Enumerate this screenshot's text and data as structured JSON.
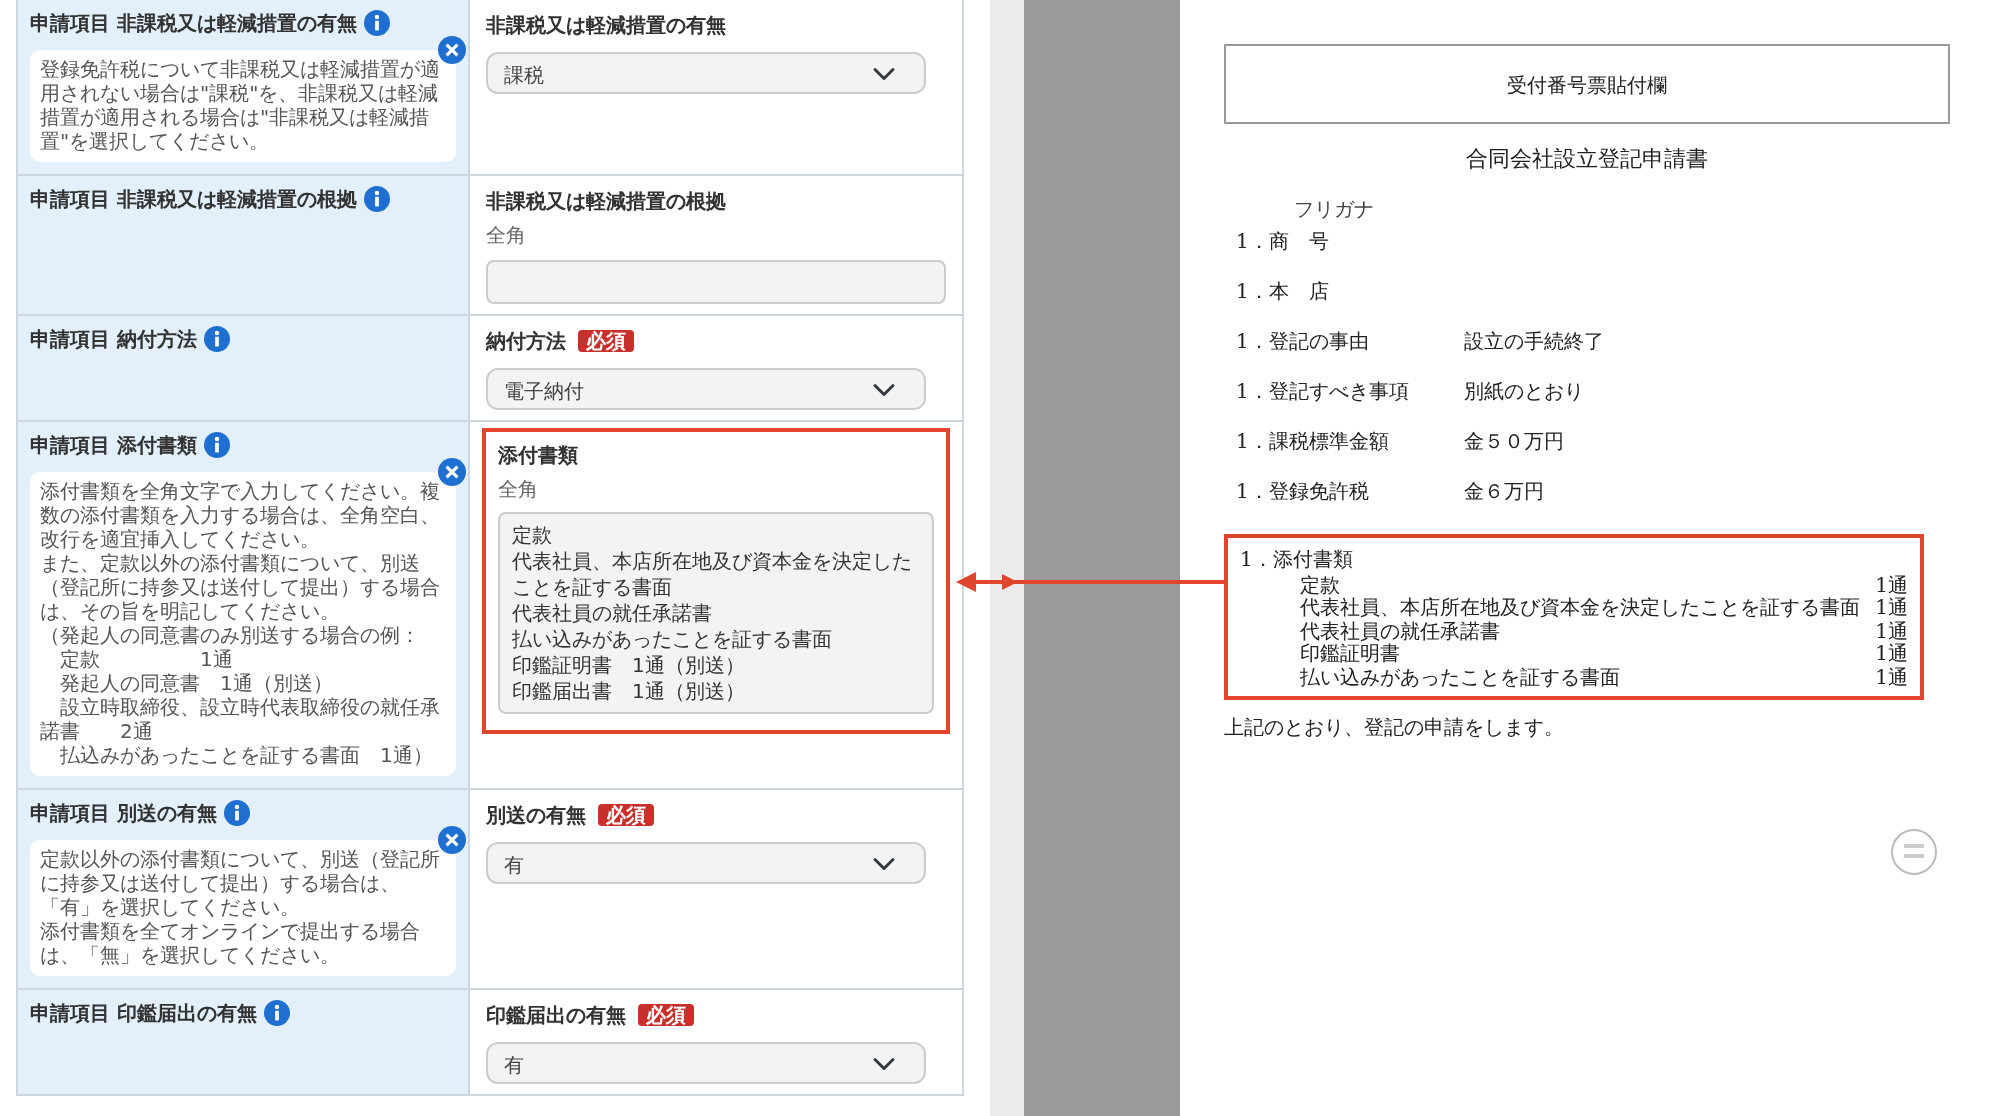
{
  "form": {
    "rows": [
      {
        "label": "申請項目 非課税又は軽減措置の有無",
        "help": [
          "登録免許税について非課税又は軽減措置が適用されない場合は\"課税\"を、非課税又は軽減措置が適用される場合は\"非課税又は軽減措置\"を選択してください。"
        ],
        "field": {
          "kind": "select",
          "label": "非課税又は軽減措置の有無",
          "value": "課税",
          "highlighted": false
        }
      },
      {
        "label": "申請項目 非課税又は軽減措置の根拠",
        "field": {
          "kind": "text",
          "label": "非課税又は軽減措置の根拠",
          "note": "全角",
          "highlighted": false
        }
      },
      {
        "label": "申請項目 納付方法",
        "field": {
          "kind": "select",
          "label": "納付方法",
          "required_badge": "必須",
          "value": "電子納付",
          "highlighted": false
        }
      },
      {
        "label": "申請項目 添付書類",
        "help": [
          "添付書類を全角文字で入力してください。複数の添付書類を入力する場合は、全角空白、改行を適宜挿入してください。",
          "また、定款以外の添付書類について、別送（登記所に持参又は送付して提出）する場合は、その旨を明記してください。",
          "（発起人の同意書のみ別送する場合の例：",
          "　定款　　　　　1通",
          "　発起人の同意書　1通（別送）",
          "　設立時取締役、設立時代表取締役の就任承諾書　　2通",
          "　払込みがあったことを証する書面　1通）"
        ],
        "field": {
          "kind": "textarea",
          "label": "添付書類",
          "note": "全角",
          "lines": [
            "定款",
            "代表社員、本店所在地及び資本金を決定したことを証する書面",
            "代表社員の就任承諾書",
            "払い込みがあったことを証する書面",
            "印鑑証明書　1通（別送）",
            "印鑑届出書　1通（別送）"
          ],
          "highlighted": true
        }
      },
      {
        "label": "申請項目 別送の有無",
        "help": [
          "定款以外の添付書類について、別送（登記所に持参又は送付して提出）する場合は、「有」を選択してください。",
          "添付書類を全てオンラインで提出する場合は、「無」を選択してください。"
        ],
        "field": {
          "kind": "select",
          "label": "別送の有無",
          "required_badge": "必須",
          "value": "有",
          "highlighted": false
        }
      },
      {
        "label": "申請項目 印鑑届出の有無",
        "field": {
          "kind": "select",
          "label": "印鑑届出の有無",
          "required_badge": "必須",
          "value": "有",
          "highlighted": false
        }
      }
    ]
  },
  "document": {
    "stamp_box": "受付番号票貼付欄",
    "title": "合同会社設立登記申請書",
    "items": [
      {
        "furigana": "フリガナ",
        "label": "1．商　号"
      },
      {
        "label": "1．本　店"
      },
      {
        "label": "1．登記の事由",
        "value": "設立の手続終了"
      },
      {
        "label": "1．登記すべき事項",
        "value": "別紙のとおり"
      },
      {
        "label": "1．課税標準金額",
        "value": "金５０万円"
      },
      {
        "label": "1．登録免許税",
        "value": "金６万円"
      }
    ],
    "attachments": {
      "label": "1．添付書類",
      "highlighted": true,
      "items": [
        {
          "name": "定款",
          "count": "1通"
        },
        {
          "name": "代表社員、本店所在地及び資本金を決定したことを証する書面",
          "count": "1通"
        },
        {
          "name": "代表社員の就任承諾書",
          "count": "1通"
        },
        {
          "name": "印鑑証明書",
          "count": "1通"
        },
        {
          "name": "払い込みがあったことを証する書面",
          "count": "1通"
        }
      ]
    },
    "closing": "上記のとおり、登記の申請をします。"
  }
}
